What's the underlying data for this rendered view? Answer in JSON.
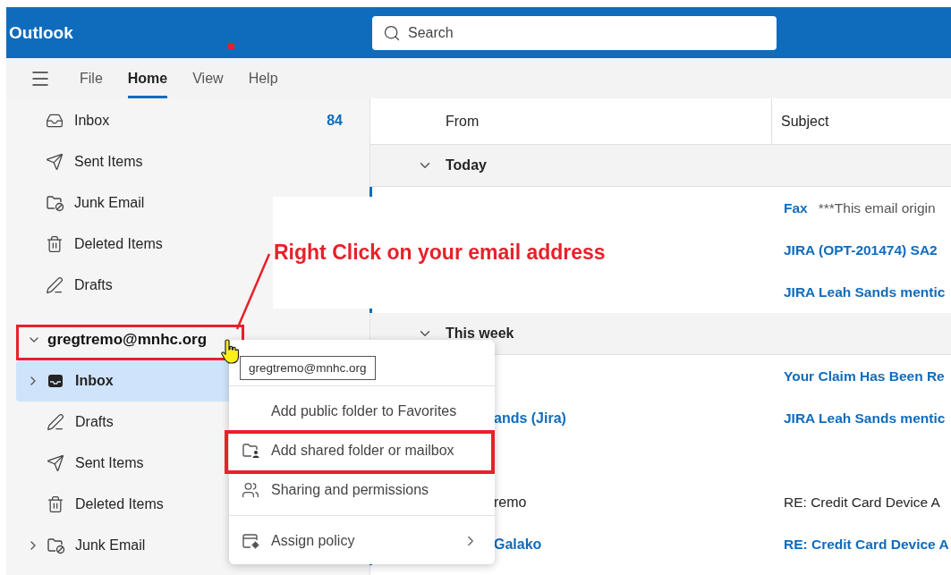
{
  "app": {
    "title": "Outlook"
  },
  "search": {
    "placeholder": "Search"
  },
  "menu_tabs": [
    {
      "label": "File",
      "selected": false
    },
    {
      "label": "Home",
      "selected": true
    },
    {
      "label": "View",
      "selected": false
    },
    {
      "label": "Help",
      "selected": false
    }
  ],
  "favorites": [
    {
      "label": "Inbox",
      "kind": "inbox",
      "count": "84"
    },
    {
      "label": "Sent Items",
      "kind": "sent"
    },
    {
      "label": "Junk Email",
      "kind": "junk"
    },
    {
      "label": "Deleted Items",
      "kind": "deleted"
    },
    {
      "label": "Drafts",
      "kind": "drafts"
    }
  ],
  "account": {
    "label": "gregtremo@mnhc.org",
    "expanded": true,
    "highlighted": true,
    "folders": [
      {
        "label": "Inbox",
        "kind": "inbox-filled",
        "selected": true,
        "expandable": true
      },
      {
        "label": "Drafts",
        "kind": "drafts",
        "selected": false,
        "expandable": false
      },
      {
        "label": "Sent Items",
        "kind": "sent",
        "selected": false,
        "expandable": false
      },
      {
        "label": "Deleted Items",
        "kind": "deleted",
        "selected": false,
        "expandable": false
      },
      {
        "label": "Junk Email",
        "kind": "junk",
        "selected": false,
        "expandable": true
      }
    ]
  },
  "message_list": {
    "columns": [
      "From",
      "Subject"
    ],
    "groups": [
      {
        "label": "Today",
        "expanded": true,
        "messages": [
          {
            "kind": "message",
            "subject": "Fax",
            "preview": "***This email origin",
            "unread": true
          },
          {
            "kind": "message",
            "subject": "JIRA (OPT-201474) SA2",
            "unread": true
          },
          {
            "kind": "message",
            "subject": "JIRA Leah Sands mentic",
            "unread": true
          }
        ]
      },
      {
        "label": "This week",
        "expanded": true,
        "messages": [
          {
            "kind": "message",
            "subject": "Your Claim Has Been Re",
            "unread": true
          },
          {
            "kind": "message",
            "from": "ands (Jira)",
            "subject": "JIRA Leah Sands mentic",
            "unread": true
          },
          {
            "kind": "covered"
          },
          {
            "kind": "message",
            "from": "remo",
            "subject": "RE: Credit Card Device A",
            "unread": false
          },
          {
            "kind": "message",
            "from": "Galako",
            "subject": "RE: Credit Card Device A",
            "unread": true
          }
        ]
      }
    ]
  },
  "annotation": {
    "text": "Right Click on your email address"
  },
  "context_menu": {
    "tooltip": "gregtremo@mnhc.org",
    "sections": [
      [
        {
          "label": "Add public folder to Favorites",
          "kind": "plain",
          "highlighted": false,
          "submenu": false
        },
        {
          "label": "Add shared folder or mailbox",
          "kind": "shared-folder",
          "highlighted": true,
          "submenu": false
        },
        {
          "label": "Sharing and permissions",
          "kind": "people",
          "highlighted": false,
          "submenu": false
        }
      ],
      [
        {
          "label": "Assign policy",
          "kind": "policy",
          "highlighted": false,
          "submenu": true
        }
      ]
    ]
  }
}
